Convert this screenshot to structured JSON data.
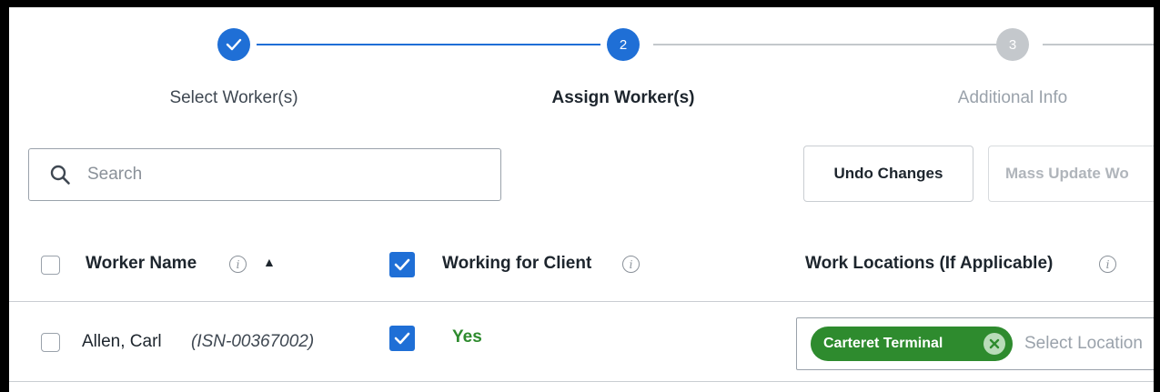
{
  "stepper": {
    "steps": [
      {
        "label": "Select Worker(s)",
        "status": "complete"
      },
      {
        "label": "Assign Worker(s)",
        "number": "2",
        "status": "active"
      },
      {
        "label": "Additional Info",
        "number": "3",
        "status": "upcoming"
      }
    ]
  },
  "toolbar": {
    "search_placeholder": "Search",
    "undo_label": "Undo Changes",
    "mass_update_label": "Mass Update Wo"
  },
  "table": {
    "headers": {
      "worker_name": "Worker Name",
      "working_for_client": "Working for Client",
      "work_locations": "Work Locations (If Applicable)"
    },
    "info_glyph": "i",
    "sort_glyph": "▲",
    "rows": [
      {
        "name": "Allen, Carl",
        "isn": "(ISN-00367002)",
        "working": "Yes",
        "location_tag": "Carteret Terminal",
        "location_placeholder": "Select Location"
      }
    ]
  },
  "colors": {
    "primary_blue": "#1f6fd6",
    "success_green": "#2e8b2e",
    "inactive_gray": "#c4c8cc"
  }
}
